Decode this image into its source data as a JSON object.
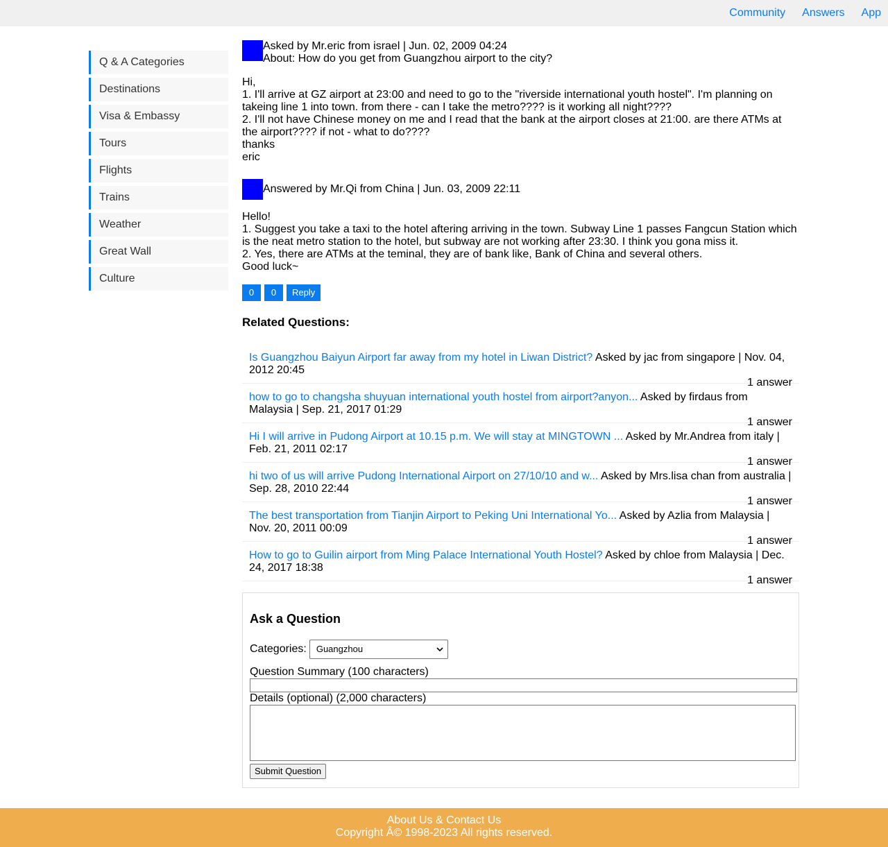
{
  "nav": {
    "items": [
      "Community",
      "Answers",
      "App"
    ]
  },
  "sidebar": {
    "items": [
      "Q & A Categories",
      "Destinations",
      "Visa & Embassy",
      "Tours",
      "Flights",
      "Trains",
      "Weather",
      "Great Wall",
      "Culture"
    ]
  },
  "question": {
    "meta": "Asked by Mr.eric from israel | Jun. 02, 2009 04:24",
    "about": "About: How do you get from Guangzhou airport to the city?",
    "body": [
      "Hi,",
      "1. I'll arrive at GZ airport at 23:00 and need to go to the \"riverside international youth hostel\". I'm planning on takeing line 1 into town. from there - can I take the metro???? is it working all night????",
      "2. I'll not have Chinese money on me and I read that the bank at the airport closes at 21:00. are there ATMs at the airport???? if not - what to do????",
      "thanks",
      "eric"
    ]
  },
  "answer": {
    "meta": "Answered by Mr.Qi from China | Jun. 03, 2009 22:11",
    "body": [
      "Hello!",
      "1. Suggest you take a taxi to the hotel aftering arriving in the town. Subway Line 1 passes Fangcun Station which is the neat metro station to the hotel, but subway are not working after 23:30. I think you gona miss it.",
      "2. Yes, there are ATMs at the teminal, they are of bank like, Bank of China and several others.",
      "Good luck~"
    ],
    "upvotes": "0",
    "downvotes": "0",
    "reply_label": "Reply"
  },
  "related": {
    "title": "Related Questions:",
    "items": [
      {
        "link": "Is Guangzhou Baiyun Airport far away from my hotel in Liwan District?",
        "meta": "Asked by jac from singapore | Nov. 04, 2012 20:45",
        "count": "1 answer"
      },
      {
        "link": "how to go to changsha shuyuan international youth hostel from airport?anyon...",
        "meta": "Asked by firdaus from Malaysia | Sep. 21, 2017 01:29",
        "count": "1 answer"
      },
      {
        "link": "Hi I will arrive in Pudong Airport at 10.15 p.m. We will stay at MINGTOWN ...",
        "meta": "Asked by Mr.Andrea from italy | Feb. 21, 2011 02:17",
        "count": "1 answer"
      },
      {
        "link": "hi two of us will arrive Pudong International Airport on 27/10/10 and w...",
        "meta": "Asked by Mrs.lisa chan from australia | Sep. 28, 2010 22:44",
        "count": "1 answer"
      },
      {
        "link": "The best transportation from Tianjin Airport to Peking Uni International Yo...",
        "meta": "Asked by Azlia from Malaysia | Nov. 20, 2011 00:09",
        "count": "1 answer"
      },
      {
        "link": "How to go to Guilin airport from Ming Palace International Youth Hostel?",
        "meta": "Asked by chloe from Malaysia | Dec. 24, 2017 18:38",
        "count": "1 answer"
      }
    ]
  },
  "ask": {
    "title": "Ask a Question",
    "categories_label": "Categories:",
    "category_value": "Guangzhou",
    "summary_label": "Question Summary (100 characters)",
    "summary_value": "",
    "details_label": "Details (optional) (2,000 characters)",
    "details_value": "",
    "submit_label": "Submit Question"
  },
  "footer": {
    "link": "About Us & Contact Us",
    "copyright": "Copyright Â© 1998-2023 All rights reserved."
  },
  "colors": {
    "accent": "#0a7cf0",
    "avatar": "#0000ff",
    "footer_bg": "#efad4e",
    "topbar_bg": "#f0f0f0"
  }
}
